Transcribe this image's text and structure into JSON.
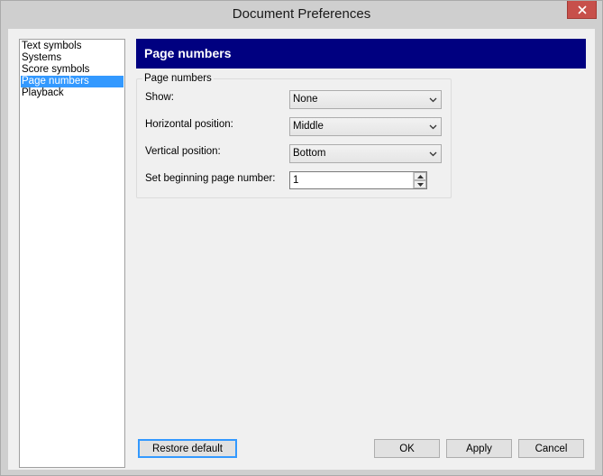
{
  "window": {
    "title": "Document Preferences"
  },
  "nav": {
    "items": [
      {
        "label": "Text symbols"
      },
      {
        "label": "Systems"
      },
      {
        "label": "Score symbols"
      },
      {
        "label": "Page numbers",
        "selected": true
      },
      {
        "label": "Playback"
      }
    ]
  },
  "panel": {
    "header": "Page numbers",
    "group_title": "Page numbers",
    "show": {
      "label": "Show:",
      "value": "None"
    },
    "horizontal": {
      "label": "Horizontal position:",
      "value": "Middle"
    },
    "vertical": {
      "label": "Vertical position:",
      "value": "Bottom"
    },
    "begin": {
      "label": "Set beginning page number:",
      "value": "1"
    }
  },
  "buttons": {
    "restore": "Restore default",
    "ok": "OK",
    "apply": "Apply",
    "cancel": "Cancel"
  },
  "colors": {
    "header_bg": "#000080",
    "selection_bg": "#3399ff",
    "close_button": "#c7504b"
  },
  "icons": {
    "close": "close-icon",
    "dropdown": "chevron-down-icon",
    "spin_up": "spin-up-icon",
    "spin_down": "spin-down-icon"
  }
}
